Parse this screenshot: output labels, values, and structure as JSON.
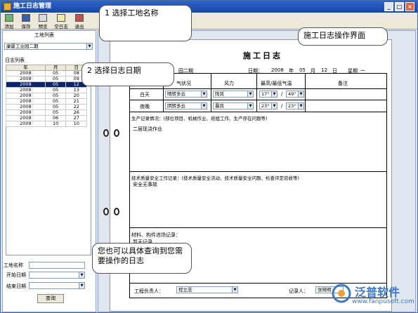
{
  "window": {
    "title": "施工日志管理",
    "btn_min": "_",
    "btn_max": "□",
    "btn_close": "×"
  },
  "toolbar": {
    "items": [
      {
        "label": "添加",
        "icon": "add-icon"
      },
      {
        "label": "保存",
        "icon": "save-icon"
      },
      {
        "label": "预览",
        "icon": "preview-icon"
      },
      {
        "label": "空日志",
        "icon": "blank-log-icon"
      },
      {
        "label": "退出",
        "icon": "exit-icon"
      }
    ]
  },
  "left": {
    "site_list_label": "工地列表",
    "site_selected": "康厦工业园二期",
    "log_list_label": "日志列表",
    "columns": [
      "年",
      "月",
      "日"
    ],
    "rows": [
      [
        "2008",
        "05",
        "08"
      ],
      [
        "2008",
        "05",
        "09"
      ],
      [
        "2008",
        "05",
        "12"
      ],
      [
        "2008",
        "05",
        "13"
      ],
      [
        "2008",
        "05",
        "20"
      ],
      [
        "2008",
        "05",
        "21"
      ],
      [
        "2008",
        "05",
        "22"
      ],
      [
        "2008",
        "05",
        "26"
      ],
      [
        "2008",
        "06",
        "27"
      ],
      [
        "2008",
        "10",
        "10"
      ]
    ],
    "selected_row": 2,
    "site_name_label": "工地名称",
    "start_date_label": "开始日期",
    "end_date_label": "结束日期",
    "query_button": "查询"
  },
  "form": {
    "title": "施工日志",
    "project_name": "园二期",
    "date_label": "日期：",
    "year": "2008",
    "year_unit": "年",
    "month": "05",
    "month_unit": "月",
    "day": "12",
    "day_unit": "日",
    "weekday_label": "星期",
    "weekday": "一",
    "weather_header": "气状况",
    "wind_header": "风力",
    "temp_header": "最高/最低气温",
    "remark_header": "备注",
    "day_label": "白天",
    "day_weather": "晴转多云",
    "day_wind": "阵风",
    "day_temp_high": "17°",
    "day_temp_low": "49°",
    "night_label": "夜晚",
    "night_weather": "阴转多云",
    "night_wind": "暴风",
    "night_temp_high": "23°",
    "night_temp_low": "23°",
    "temp_sep": "/",
    "production_label": "生产记录情况：(部位项目、机械作业、班组工作、生产存在问题等)",
    "production_text": "二层现浇作业",
    "safety_label": "技术质量安全工作记录：(技术质量安全活动、技术质量安全问题、检查评定验收等)",
    "safety_text": "安全无事故",
    "material_label": "材料、构件进场记录：",
    "material_text": "暂无记录",
    "engineer_label": "工程负责人：",
    "engineer": "程立志",
    "recorder_label": "记录人：",
    "recorder": "张晓明"
  },
  "callouts": {
    "c1": "1 选择工地名称",
    "c2": "2 选择日志日期",
    "c3": "施工日志操作界面",
    "c4": "您也可以具体查询到您需要操作的日志"
  },
  "watermark": {
    "brand": "泛普软件",
    "url": "www.fanpusoft.com"
  }
}
